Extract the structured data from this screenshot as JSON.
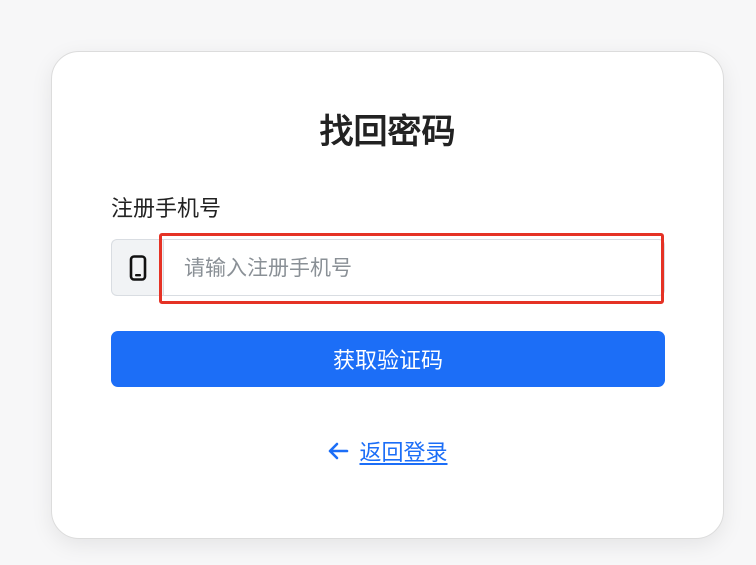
{
  "form": {
    "title": "找回密码",
    "phone_label": "注册手机号",
    "phone_placeholder": "请输入注册手机号",
    "phone_value": "",
    "submit_label": "获取验证码",
    "back_label": "返回登录"
  },
  "icons": {
    "phone": "mobile-phone-icon",
    "back": "arrow-left-icon"
  },
  "colors": {
    "accent": "#1c6ef7",
    "highlight": "#e53225"
  }
}
